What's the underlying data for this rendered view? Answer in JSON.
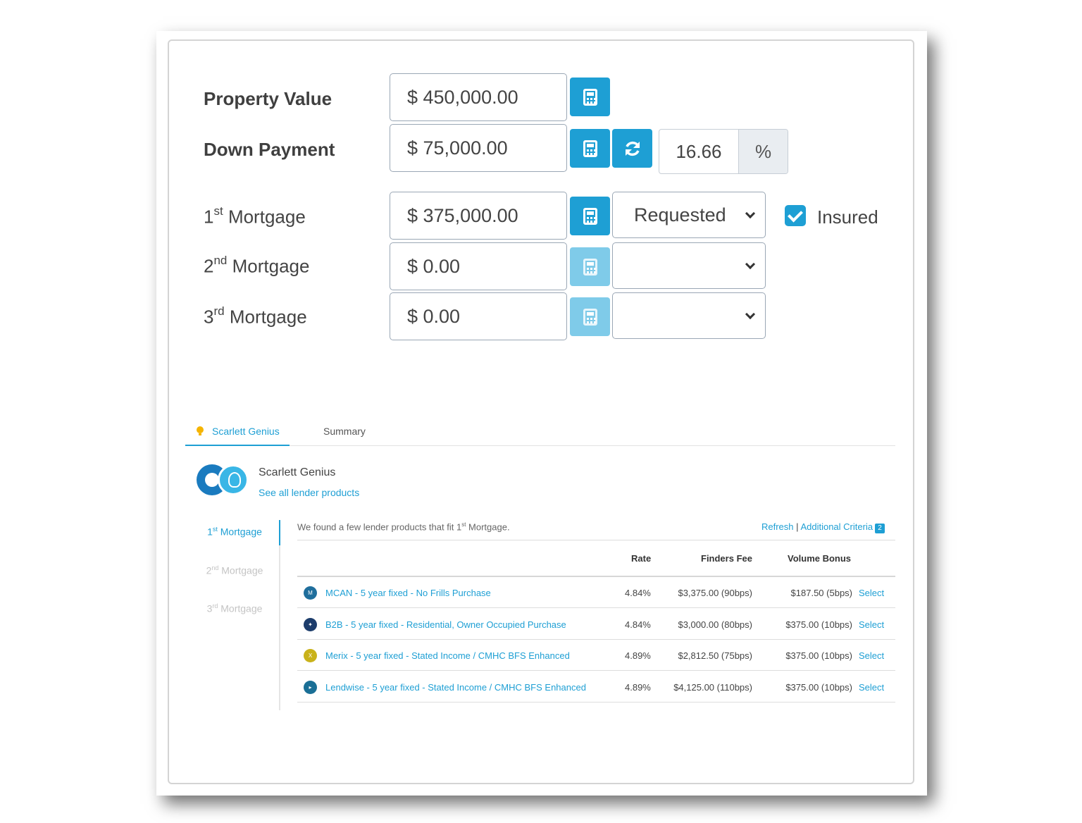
{
  "form": {
    "property_value": {
      "label": "Property Value",
      "value": "$ 450,000.00"
    },
    "down_payment": {
      "label": "Down Payment",
      "value": "$ 75,000.00",
      "percent": "16.66",
      "percent_symbol": "%"
    },
    "mortgages": [
      {
        "ordinal": "1",
        "suffix": "st",
        "word": "Mortgage",
        "value": "$ 375,000.00",
        "select": "Requested"
      },
      {
        "ordinal": "2",
        "suffix": "nd",
        "word": "Mortgage",
        "value": "$ 0.00",
        "select": ""
      },
      {
        "ordinal": "3",
        "suffix": "rd",
        "word": "Mortgage",
        "value": "$ 0.00",
        "select": ""
      }
    ],
    "insured": {
      "label": "Insured",
      "checked": true
    }
  },
  "tabs": {
    "genius": "Scarlett Genius",
    "summary": "Summary"
  },
  "genius": {
    "title": "Scarlett Genius",
    "link": "See all lender products",
    "side": [
      {
        "ordinal": "1",
        "suffix": "st",
        "word": "Mortgage"
      },
      {
        "ordinal": "2",
        "suffix": "nd",
        "word": "Mortgage"
      },
      {
        "ordinal": "3",
        "suffix": "rd",
        "word": "Mortgage"
      }
    ],
    "found_prefix": "We found a few lender products that fit 1",
    "found_sup": "st",
    "found_suffix": " Mortgage.",
    "refresh": "Refresh",
    "separator": "|",
    "additional": "Additional Criteria",
    "badge": "2",
    "headers": {
      "rate": "Rate",
      "fee": "Finders Fee",
      "bonus": "Volume Bonus"
    },
    "rows": [
      {
        "icon": "mcan-logo",
        "icon_text": "M",
        "color": "#1f6e9c",
        "name": "MCAN - 5 year fixed - No Frills Purchase",
        "rate": "4.84%",
        "fee": "$3,375.00 (90bps)",
        "bonus": "$187.50 (5bps)",
        "select": "Select"
      },
      {
        "icon": "b2b-logo",
        "icon_text": "✦",
        "color": "#1c3c6b",
        "name": "B2B - 5 year fixed - Residential, Owner Occupied Purchase",
        "rate": "4.84%",
        "fee": "$3,000.00 (80bps)",
        "bonus": "$375.00 (10bps)",
        "select": "Select"
      },
      {
        "icon": "merix-logo",
        "icon_text": "X",
        "color": "#c9b21a",
        "name": "Merix - 5 year fixed - Stated Income / CMHC BFS Enhanced",
        "rate": "4.89%",
        "fee": "$2,812.50 (75bps)",
        "bonus": "$375.00 (10bps)",
        "select": "Select"
      },
      {
        "icon": "lendwise-logo",
        "icon_text": "▸",
        "color": "#1a6f96",
        "name": "Lendwise - 5 year fixed - Stated Income / CMHC BFS Enhanced",
        "rate": "4.89%",
        "fee": "$4,125.00 (110bps)",
        "bonus": "$375.00 (10bps)",
        "select": "Select"
      }
    ]
  },
  "colors": {
    "accent": "#1e9fd4",
    "accent_disabled": "#7fcbe9"
  }
}
